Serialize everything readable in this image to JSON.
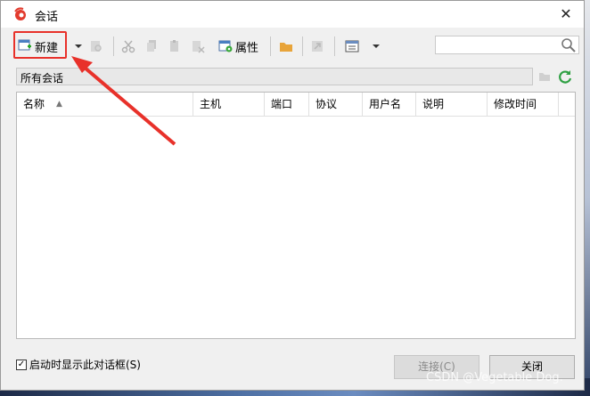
{
  "window": {
    "title": "会话",
    "close_glyph": "✕"
  },
  "toolbar": {
    "new_label": "新建",
    "properties_label": "属性",
    "search_placeholder": ""
  },
  "pathbar": {
    "label": "所有会话"
  },
  "table": {
    "columns": [
      "名称",
      "主机",
      "端口",
      "协议",
      "用户名",
      "说明",
      "修改时间"
    ],
    "sort_indicator": "▲",
    "rows": []
  },
  "footer": {
    "show_on_startup_label": "启动时显示此对话框(S)",
    "show_on_startup_checked": true,
    "connect_label": "连接(C)",
    "close_label": "关闭"
  },
  "watermark": "CSDN @Vegetable Dog.",
  "colors": {
    "highlight": "#e8312a",
    "accent": "#2b7de0"
  }
}
